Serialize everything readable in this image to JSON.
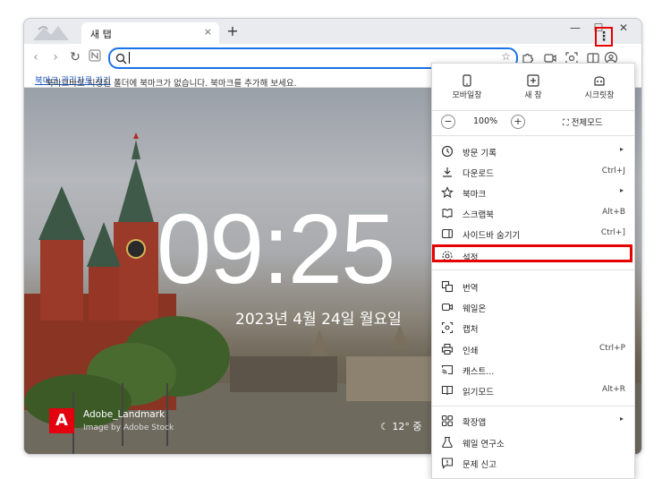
{
  "tab": {
    "title": "새 탭",
    "close": "×",
    "new": "+"
  },
  "window_controls": {
    "minimize": "—",
    "maximize": "☐",
    "close": "✕"
  },
  "toolbar": {
    "menu_glyph": "⋮"
  },
  "bookmark_bar": {
    "message": "북마크바로 지정된 폴더에 북마크가 없습니다. 북마크를 추가해 보세요.",
    "link": "북마크 관리자로 가기"
  },
  "newtab": {
    "time": "09:25",
    "date": "2023년 4월 24일 월요일",
    "credit_title": "Adobe_Landmark",
    "credit_sub": "Image by Adobe Stock",
    "weather": "12° 중"
  },
  "menu": {
    "top_buttons": [
      {
        "label": "모바일창",
        "icon": "mobile-icon"
      },
      {
        "label": "새 창",
        "icon": "new-window-icon"
      },
      {
        "label": "시크릿창",
        "icon": "incognito-icon"
      }
    ],
    "zoom": {
      "minus": "−",
      "value": "100%",
      "plus": "+",
      "fullscreen": "전체모드"
    },
    "items": [
      {
        "label": "방문 기록",
        "shortcut": "",
        "arrow": "▸",
        "icon": "history-icon"
      },
      {
        "label": "다운로드",
        "shortcut": "Ctrl+J",
        "arrow": "",
        "icon": "download-icon"
      },
      {
        "label": "북마크",
        "shortcut": "",
        "arrow": "▸",
        "icon": "bookmark-star-icon"
      },
      {
        "label": "스크랩북",
        "shortcut": "Alt+B",
        "arrow": "",
        "icon": "scrapbook-icon"
      },
      {
        "label": "사이드바 숨기기",
        "shortcut": "Ctrl+]",
        "arrow": "",
        "icon": "sidebar-icon"
      },
      {
        "label": "설정",
        "shortcut": "",
        "arrow": "",
        "icon": "gear-icon"
      },
      {
        "label": "번역",
        "shortcut": "",
        "arrow": "",
        "icon": "translate-icon"
      },
      {
        "label": "웨일온",
        "shortcut": "",
        "arrow": "",
        "icon": "video-call-icon"
      },
      {
        "label": "캡처",
        "shortcut": "",
        "arrow": "",
        "icon": "capture-icon"
      },
      {
        "label": "인쇄",
        "shortcut": "Ctrl+P",
        "arrow": "",
        "icon": "print-icon"
      },
      {
        "label": "캐스트...",
        "shortcut": "",
        "arrow": "",
        "icon": "cast-icon"
      },
      {
        "label": "읽기모드",
        "shortcut": "Alt+R",
        "arrow": "",
        "icon": "reading-mode-icon"
      },
      {
        "label": "확장앱",
        "shortcut": "",
        "arrow": "▸",
        "icon": "extensions-icon"
      },
      {
        "label": "웨일 연구소",
        "shortcut": "",
        "arrow": "",
        "icon": "lab-flask-icon"
      },
      {
        "label": "문제 신고",
        "shortcut": "",
        "arrow": "",
        "icon": "report-icon"
      }
    ]
  },
  "colors": {
    "accent": "#1a73e8",
    "highlight": "#e60000",
    "link": "#1a56c4"
  }
}
